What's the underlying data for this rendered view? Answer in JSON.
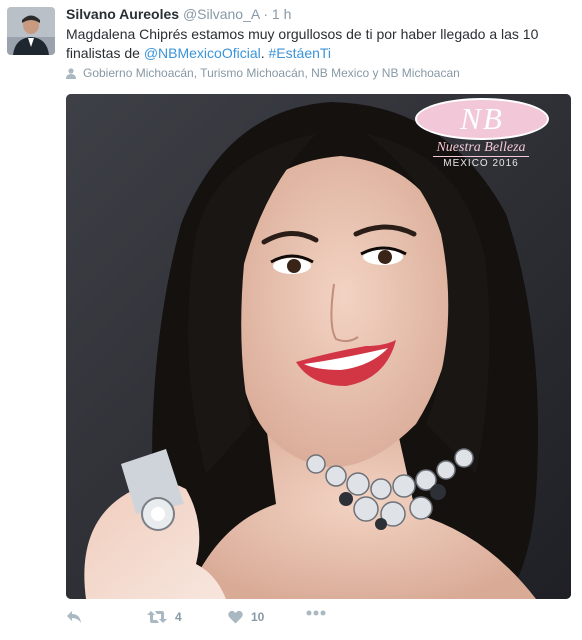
{
  "tweet": {
    "author_name": "Silvano Aureoles",
    "author_handle": "@Silvano_A",
    "separator": "·",
    "time": "1 h",
    "text_prefix": "Magdalena Chiprés estamos muy orgullosos de ti por haber llegado a las 10 finalistas de ",
    "mention": "@NBMexicoOficial",
    "text_middle": ". ",
    "hashtag": "#EstáenTi",
    "tagged_people": "Gobierno Michoacán, Turismo Michoacán, NB Mexico y NB Michoacan"
  },
  "media": {
    "logo_initials": "NB",
    "logo_title": "Nuestra Belleza",
    "logo_subtitle": "MEXICO 2016"
  },
  "actions": {
    "retweet_count": "4",
    "like_count": "10"
  },
  "colors": {
    "link": "#3b94d9",
    "secondary_text": "#8899a6",
    "action_icon": "#aab8c2",
    "logo_pink": "#f2c8d8"
  },
  "icons": [
    "avatar-photo",
    "person-tag-icon",
    "reply-icon",
    "retweet-icon",
    "heart-icon",
    "more-icon"
  ]
}
